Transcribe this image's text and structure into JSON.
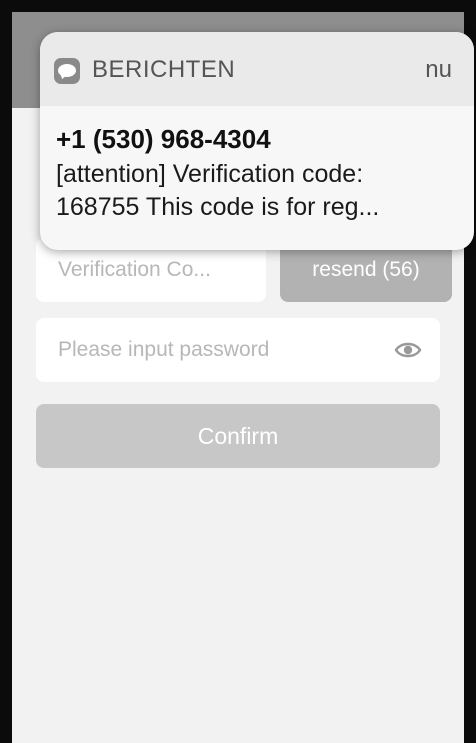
{
  "notification": {
    "app_name": "BERICHTEN",
    "time": "nu",
    "sender": "+1 (530) 968-4304",
    "message": "[attention] Verification code:\n168755 This code is for reg...",
    "icon": "messages-icon"
  },
  "form": {
    "verification_placeholder": "Verification Co...",
    "resend_label": "resend (56)",
    "password_placeholder": "Please input password",
    "password_toggle_icon": "eye-icon",
    "confirm_label": "Confirm"
  },
  "colors": {
    "primary_disabled": "#c7c7c7",
    "resend_disabled": "#b2b2b2",
    "background": "#f2f2f2"
  }
}
